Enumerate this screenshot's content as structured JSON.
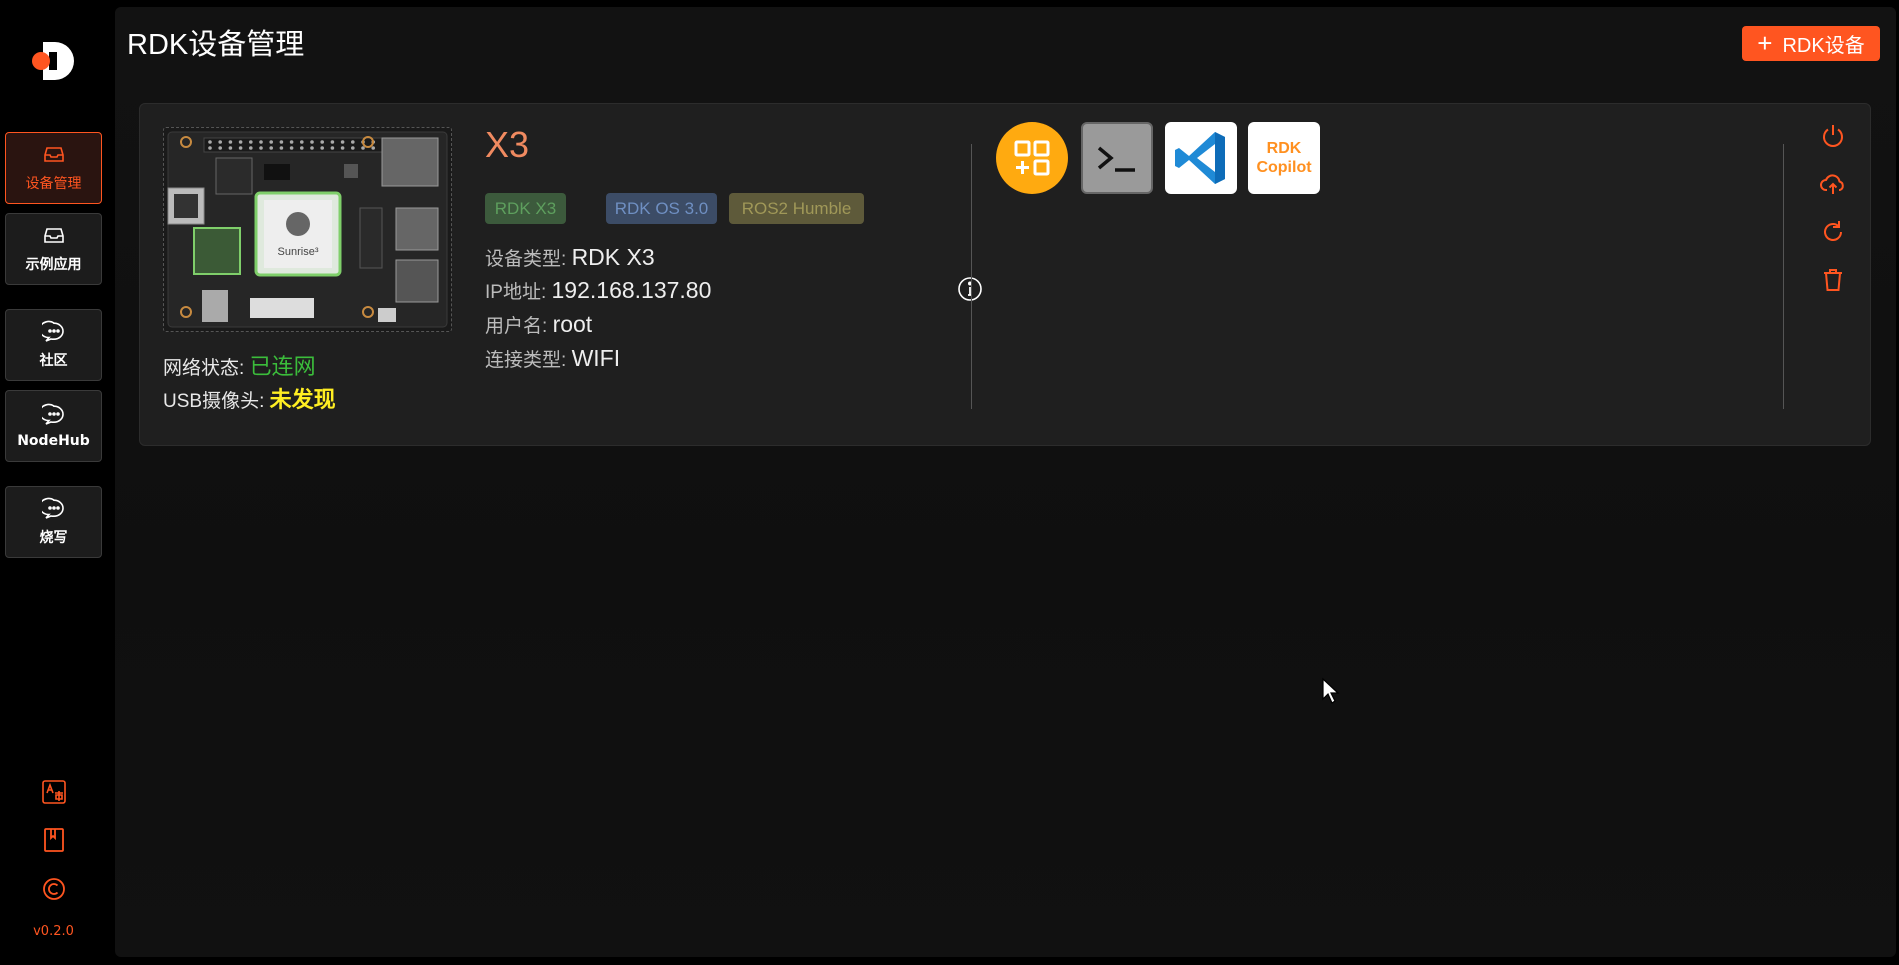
{
  "app": {
    "title": "RDK设备管理",
    "add_button_label": "RDK设备",
    "version": "v0.2.0"
  },
  "sidebar": {
    "items": [
      {
        "label": "设备管理",
        "icon": "inbox-icon",
        "active": true
      },
      {
        "label": "示例应用",
        "icon": "inbox-icon",
        "active": false
      },
      {
        "label": "社区",
        "icon": "chat-bubble-icon",
        "active": false
      },
      {
        "label": "NodeHub",
        "icon": "chat-bubble-icon",
        "active": false
      },
      {
        "label": "烧写",
        "icon": "chat-bubble-icon",
        "active": false
      }
    ],
    "tools": [
      "language-icon",
      "book-icon",
      "copyright-icon"
    ]
  },
  "device": {
    "name": "X3",
    "tags": [
      "RDK X3",
      "RDK OS 3.0",
      "ROS2 Humble"
    ],
    "board_chip_label": "Sunrise³",
    "network_label": "网络状态:",
    "network_value": "已连网",
    "usb_label": "USB摄像头:",
    "usb_value": "未发现",
    "type_label": "设备类型:",
    "type_value": "RDK X3",
    "ip_label": "IP地址:",
    "ip_value": "192.168.137.80",
    "user_label": "用户名:",
    "user_value": "root",
    "conn_label": "连接类型:",
    "conn_value": "WIFI"
  },
  "apps": [
    {
      "name": "app-store-icon"
    },
    {
      "name": "terminal-icon"
    },
    {
      "name": "vscode-icon"
    },
    {
      "name": "rdk-copilot-icon",
      "line1": "RDK",
      "line2": "Copilot"
    }
  ],
  "actions": [
    "power-icon",
    "cloud-upload-icon",
    "refresh-icon",
    "trash-icon"
  ],
  "colors": {
    "accent": "#ff5520",
    "connected": "#3bbd3b",
    "not_found": "#ffee22",
    "device_name": "#f08a60"
  }
}
